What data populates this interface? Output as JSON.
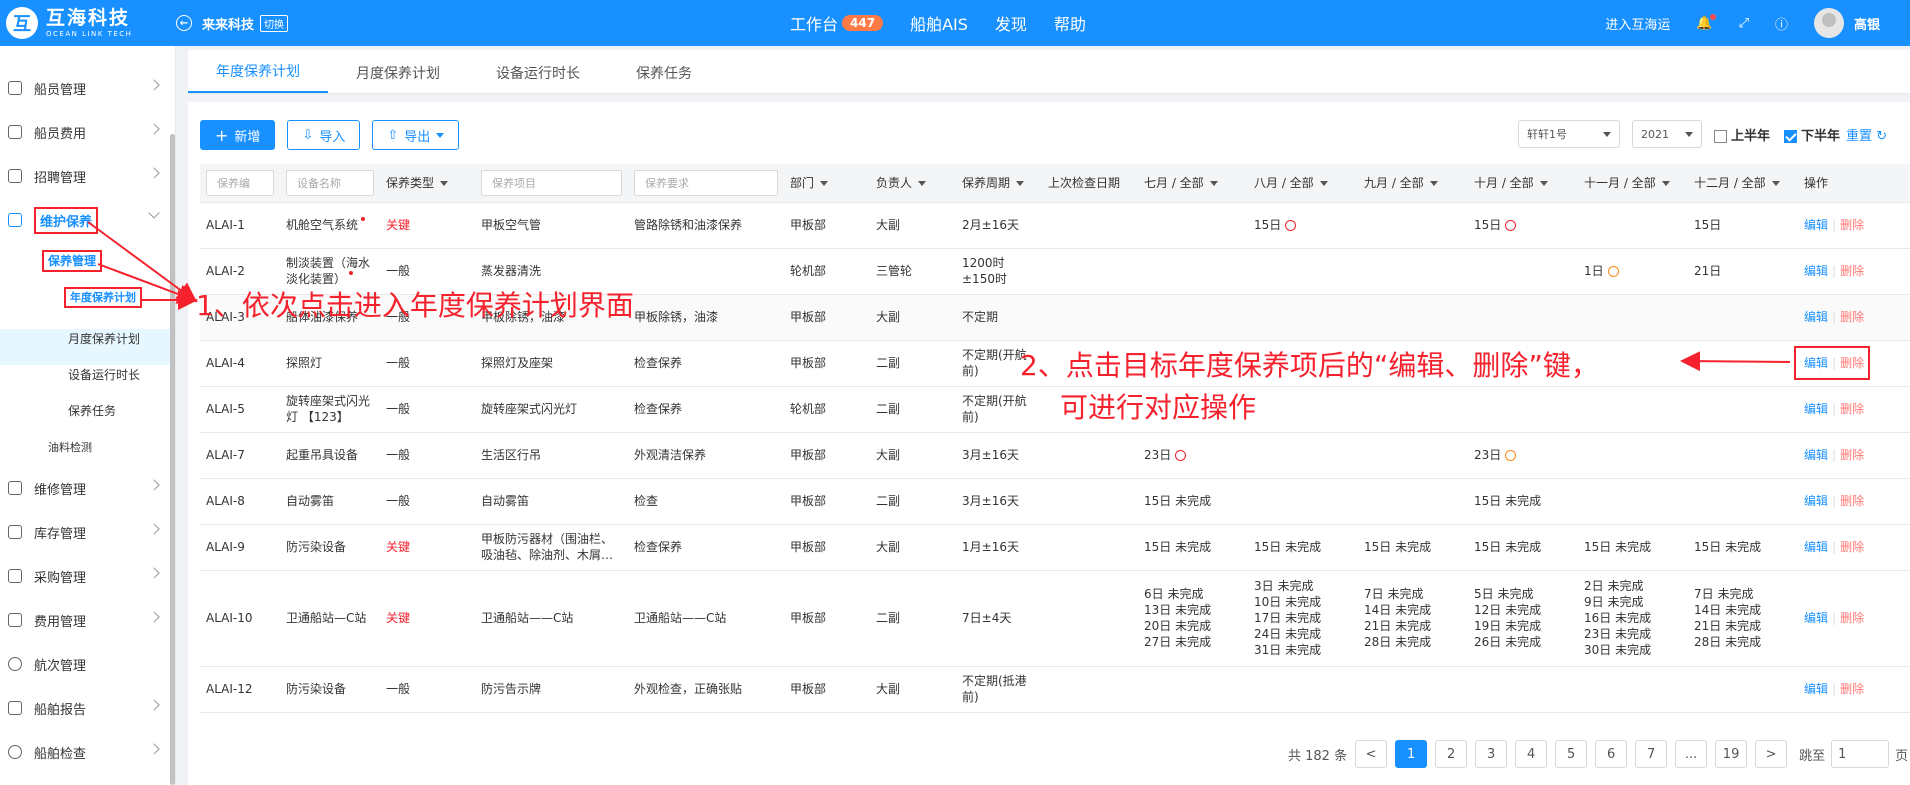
{
  "header": {
    "logo_cn": "互海科技",
    "logo_en": "OCEAN LINK TECH",
    "company": "来来科技",
    "switch_label": "切换",
    "nav": [
      "工作台",
      "船舶AIS",
      "发现",
      "帮助"
    ],
    "workbench_badge": "447",
    "enter_label": "进入互海运",
    "username": "高银"
  },
  "sidebar": {
    "items": [
      "船员管理",
      "船员费用",
      "招聘管理",
      "维护保养",
      "维修管理",
      "库存管理",
      "采购管理",
      "费用管理",
      "航次管理",
      "船舶报告",
      "船舶检查"
    ],
    "sub_group": "保养管理",
    "sub_items": [
      "年度保养计划",
      "月度保养计划",
      "设备运行时长",
      "保养任务"
    ],
    "oil_check": "油料检测"
  },
  "tabs": [
    "年度保养计划",
    "月度保养计划",
    "设备运行时长",
    "保养任务"
  ],
  "toolbar": {
    "add": "新增",
    "import": "导入",
    "export": "导出",
    "ship": "轩轩1号",
    "year": "2021",
    "first_half": "上半年",
    "second_half": "下半年",
    "reset": "重置"
  },
  "table": {
    "filters": [
      "保养编",
      "设备名称",
      "保养类型",
      "保养项目",
      "保养要求"
    ],
    "headers": [
      "部门",
      "负责人",
      "保养周期",
      "上次检查日期",
      "七月 / 全部",
      "八月 / 全部",
      "九月 / 全部",
      "十月 / 全部",
      "十一月 / 全部",
      "十二月 / 全部",
      "操作"
    ],
    "edit": "编辑",
    "delete": "删除",
    "rows": [
      {
        "code": "ALAI-1",
        "device": "机舱空气系统",
        "type": "关键",
        "item": "甲板空气管",
        "req": "管路除锈和油漆保养",
        "dept": "甲板部",
        "owner": "大副",
        "cycle": "2月±16天",
        "m7": "",
        "m8": "15日",
        "m9": "",
        "m10": "15日",
        "m11": "",
        "m12": "15日"
      },
      {
        "code": "ALAI-2",
        "device": "制淡装置（海水淡化装置）",
        "type": "一般",
        "item": "蒸发器清洗",
        "req": "",
        "dept": "轮机部",
        "owner": "三管轮",
        "cycle": "1200时 ±150时",
        "m7": "",
        "m8": "",
        "m9": "",
        "m10": "",
        "m11": "1日",
        "m12": "21日"
      },
      {
        "code": "ALAI-3",
        "device": "船体油漆保养",
        "type": "一般",
        "item": "甲板除锈，油漆",
        "req": "甲板除锈，油漆",
        "dept": "甲板部",
        "owner": "大副",
        "cycle": "不定期",
        "m7": "",
        "m8": "",
        "m9": "",
        "m10": "",
        "m11": "",
        "m12": ""
      },
      {
        "code": "ALAI-4",
        "device": "探照灯",
        "type": "一般",
        "item": "探照灯及座架",
        "req": "检查保养",
        "dept": "甲板部",
        "owner": "二副",
        "cycle": "不定期(开航前)",
        "m7": "",
        "m8": "",
        "m9": "",
        "m10": "",
        "m11": "",
        "m12": ""
      },
      {
        "code": "ALAI-5",
        "device": "旋转座架式闪光灯 【123】",
        "type": "一般",
        "item": "旋转座架式闪光灯",
        "req": "检查保养",
        "dept": "轮机部",
        "owner": "二副",
        "cycle": "不定期(开航前)",
        "m7": "",
        "m8": "",
        "m9": "",
        "m10": "",
        "m11": "",
        "m12": ""
      },
      {
        "code": "ALAI-7",
        "device": "起重吊具设备",
        "type": "一般",
        "item": "生活区行吊",
        "req": "外观清洁保养",
        "dept": "甲板部",
        "owner": "大副",
        "cycle": "3月±16天",
        "m7": "23日",
        "m8": "",
        "m9": "",
        "m10": "23日",
        "m11": "",
        "m12": ""
      },
      {
        "code": "ALAI-8",
        "device": "自动雾笛",
        "type": "一般",
        "item": "自动雾笛",
        "req": "检查",
        "dept": "甲板部",
        "owner": "二副",
        "cycle": "3月±16天",
        "m7": "15日 未完成",
        "m8": "",
        "m9": "",
        "m10": "15日 未完成",
        "m11": "",
        "m12": ""
      },
      {
        "code": "ALAI-9",
        "device": "防污染设备",
        "type": "关键",
        "item": "甲板防污器材（围油栏、吸油毡、除油剂、木屑…",
        "req": "检查保养",
        "dept": "甲板部",
        "owner": "大副",
        "cycle": "1月±16天",
        "m7": "15日 未完成",
        "m8": "15日 未完成",
        "m9": "15日 未完成",
        "m10": "15日 未完成",
        "m11": "15日 未完成",
        "m12": "15日 未完成"
      },
      {
        "code": "ALAI-10",
        "device": "卫通船站—C站",
        "type": "关键",
        "item": "卫通船站——C站",
        "req": "卫通船站——C站",
        "dept": "甲板部",
        "owner": "二副",
        "cycle": "7日±4天",
        "m7": "6日 未完成\n13日 未完成\n20日 未完成\n27日 未完成",
        "m8": "3日 未完成\n10日 未完成\n17日 未完成\n24日 未完成\n31日 未完成",
        "m9": "7日 未完成\n14日 未完成\n21日 未完成\n28日 未完成",
        "m10": "5日 未完成\n12日 未完成\n19日 未完成\n26日 未完成",
        "m11": "2日 未完成\n9日 未完成\n16日 未完成\n23日 未完成\n30日 未完成",
        "m12": "7日 未完成\n14日 未完成\n21日 未完成\n28日 未完成"
      },
      {
        "code": "ALAI-12",
        "device": "防污染设备",
        "type": "一般",
        "item": "防污告示牌",
        "req": "外观检查，正确张贴",
        "dept": "甲板部",
        "owner": "大副",
        "cycle": "不定期(抵港前)",
        "m7": "",
        "m8": "",
        "m9": "",
        "m10": "",
        "m11": "",
        "m12": ""
      }
    ]
  },
  "pagination": {
    "total": "共 182 条",
    "prev": "<",
    "pages": [
      "1",
      "2",
      "3",
      "4",
      "5",
      "6",
      "7",
      "...",
      "19"
    ],
    "next": ">",
    "jump_to": "跳至",
    "page_value": "1",
    "page_unit": "页"
  },
  "annotations": {
    "step1": "1、依次点击进入年度保养计划界面",
    "step2_line1": "2、点击目标年度保养项后的“编辑、删除”键，",
    "step2_line2": "可进行对应操作"
  },
  "colors": {
    "brand": "#1890ff",
    "annotation": "#f5222d",
    "badge": "#ff7a45"
  }
}
